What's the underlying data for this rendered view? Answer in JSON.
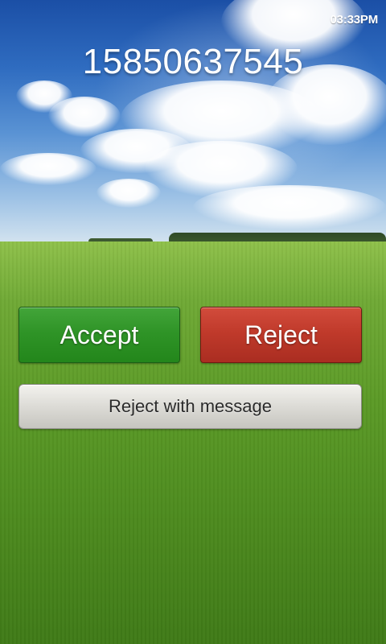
{
  "status_bar": {
    "time": "03:33PM"
  },
  "incoming_call": {
    "caller_number": "15850637545"
  },
  "actions": {
    "accept_label": "Accept",
    "reject_label": "Reject",
    "reject_with_message_label": "Reject with message"
  },
  "colors": {
    "accept": "#2f9427",
    "reject": "#c03a2b",
    "secondary_button": "#dcdbd6"
  },
  "wallpaper": {
    "icon": "field-and-sky-wallpaper"
  }
}
